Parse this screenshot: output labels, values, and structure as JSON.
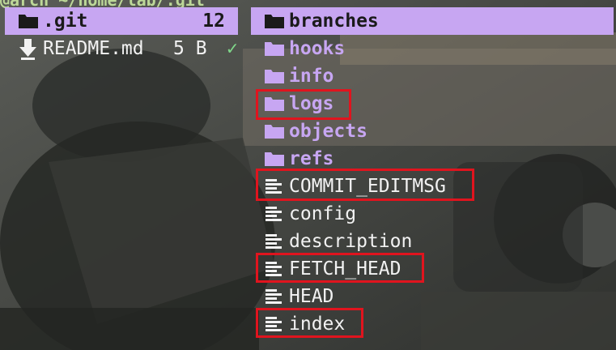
{
  "path_bar": "@arch ~/home/lab/.git",
  "parent_pane": {
    "header": {
      "name": ".git",
      "count": "12",
      "icon": "folder-icon"
    },
    "entries": [
      {
        "name": "README.md",
        "size": "5 B",
        "status": "✓",
        "icon": "download-arrow-icon"
      }
    ]
  },
  "current_pane": {
    "entries": [
      {
        "name": "branches",
        "kind": "dir",
        "icon": "folder-icon",
        "selected": true
      },
      {
        "name": "hooks",
        "kind": "dir",
        "icon": "folder-icon"
      },
      {
        "name": "info",
        "kind": "dir",
        "icon": "folder-icon"
      },
      {
        "name": "logs",
        "kind": "dir",
        "icon": "folder-icon",
        "highlighted": true
      },
      {
        "name": "objects",
        "kind": "dir",
        "icon": "folder-icon"
      },
      {
        "name": "refs",
        "kind": "dir",
        "icon": "folder-icon"
      },
      {
        "name": "COMMIT_EDITMSG",
        "kind": "file",
        "icon": "text-file-icon",
        "highlighted": true
      },
      {
        "name": "config",
        "kind": "file",
        "icon": "text-file-icon"
      },
      {
        "name": "description",
        "kind": "file",
        "icon": "text-file-icon"
      },
      {
        "name": "FETCH_HEAD",
        "kind": "file",
        "icon": "text-file-icon",
        "highlighted": true
      },
      {
        "name": "HEAD",
        "kind": "file",
        "icon": "text-file-icon"
      },
      {
        "name": "index",
        "kind": "file",
        "icon": "text-file-icon",
        "highlighted": true
      }
    ]
  },
  "colors": {
    "selection": "#c7a6f2",
    "directory": "#c7a6f2",
    "file": "#f2f2f2",
    "highlight_box": "#e0141e",
    "status_ok": "#7fd68a"
  }
}
